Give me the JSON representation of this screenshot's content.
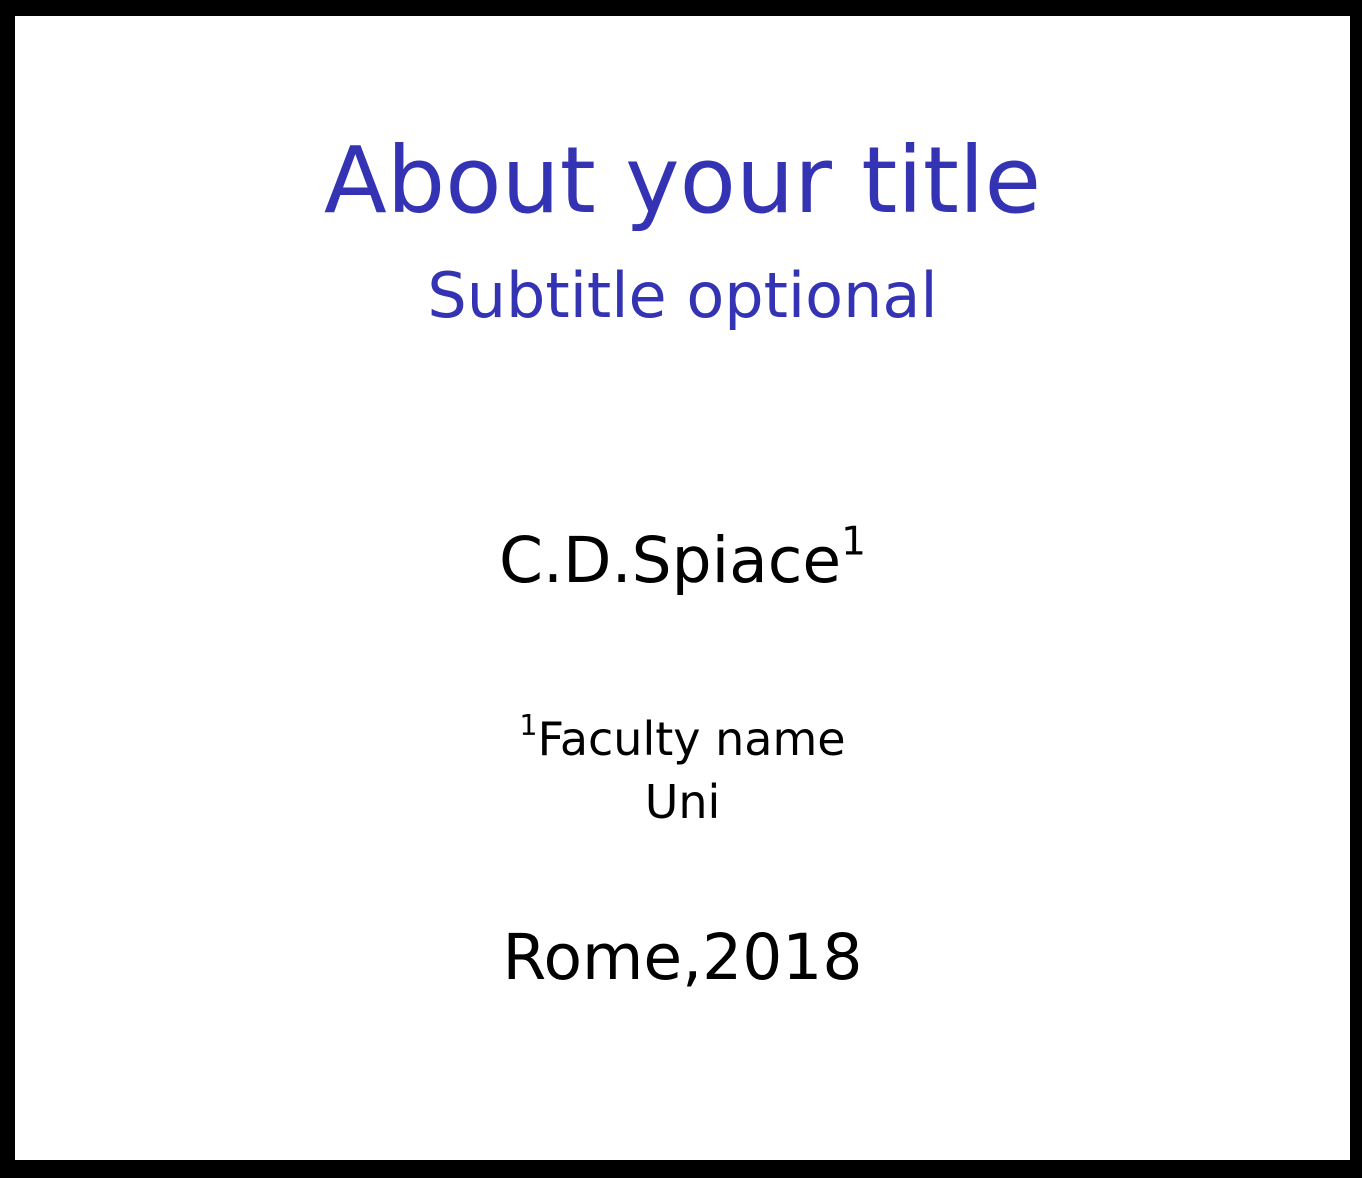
{
  "title": "About your title",
  "subtitle": "Subtitle optional",
  "author": {
    "name": "C.D.Spiace",
    "affiliation_mark": "1"
  },
  "affiliation": {
    "mark": "1",
    "faculty": "Faculty name",
    "university": "Uni"
  },
  "date_place": "Rome,2018",
  "colors": {
    "title": "#3333b3",
    "text": "#000000",
    "frame": "#000000",
    "background": "#ffffff"
  }
}
